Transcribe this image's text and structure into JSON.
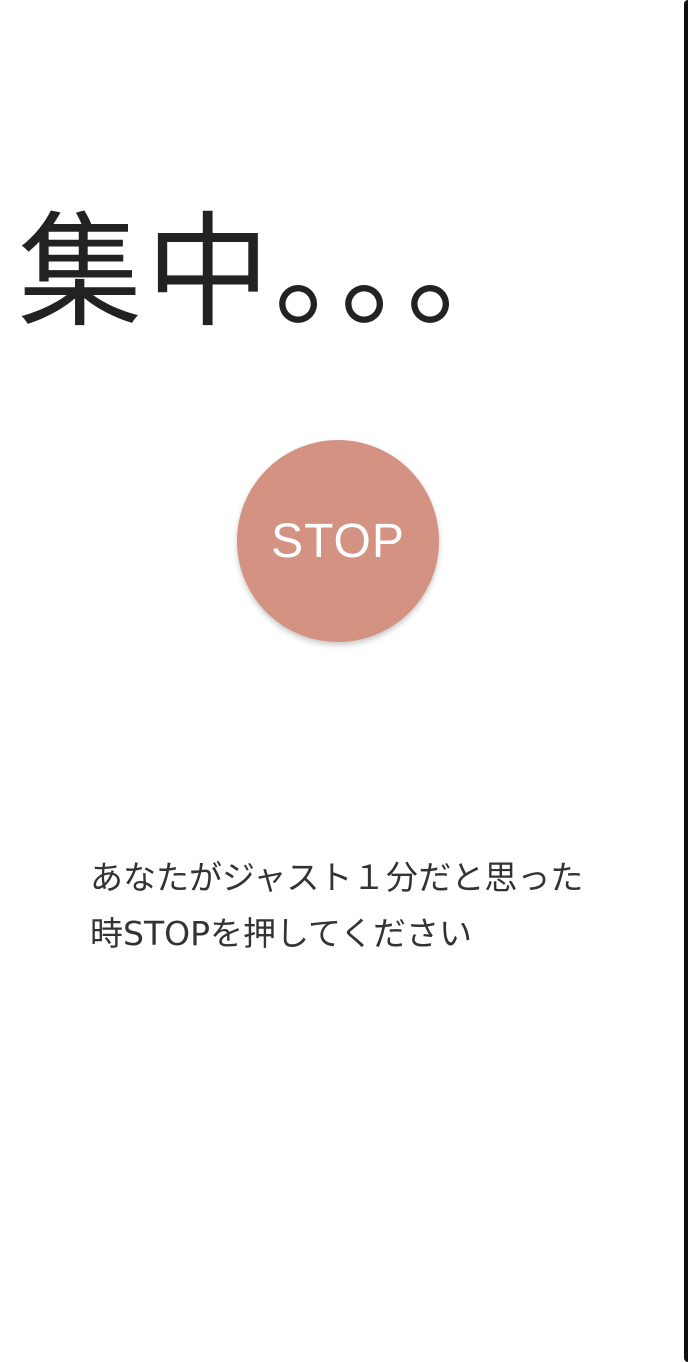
{
  "header": {
    "title": "集中。。。"
  },
  "stop_button": {
    "label": "STOP",
    "color": "#d49282"
  },
  "instruction": {
    "text": "あなたがジャスト１分だと思った時STOPを押してください"
  }
}
